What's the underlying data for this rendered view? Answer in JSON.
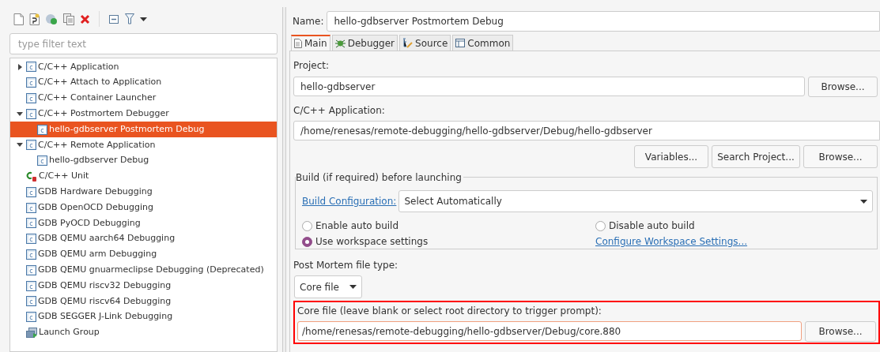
{
  "toolbar": {
    "buttons": [
      {
        "kind": "new"
      },
      {
        "kind": "new-prototype"
      },
      {
        "kind": "export"
      },
      {
        "kind": "duplicate"
      },
      {
        "kind": "delete"
      },
      {
        "kind": "collapse"
      },
      {
        "kind": "filter"
      },
      {
        "kind": "menu"
      }
    ]
  },
  "filter": {
    "placeholder": "type filter text"
  },
  "tree": [
    {
      "label": "C/C++ Application",
      "kind": "c",
      "expanded": false,
      "selected": false
    },
    {
      "label": "C/C++ Attach to Application",
      "kind": "c",
      "selected": false
    },
    {
      "label": "C/C++ Container Launcher",
      "kind": "c",
      "selected": false
    },
    {
      "label": "C/C++ Postmortem Debugger",
      "kind": "c",
      "expanded": true,
      "selected": false,
      "children": [
        {
          "label": "hello-gdbserver Postmortem Debug",
          "kind": "c",
          "selected": true
        }
      ]
    },
    {
      "label": "C/C++ Remote Application",
      "kind": "c",
      "expanded": true,
      "selected": false,
      "children": [
        {
          "label": "hello-gdbserver Debug",
          "kind": "c",
          "selected": false
        }
      ]
    },
    {
      "label": "C/C++ Unit",
      "kind": "unit",
      "selected": false
    },
    {
      "label": "GDB Hardware Debugging",
      "kind": "c",
      "selected": false
    },
    {
      "label": "GDB OpenOCD Debugging",
      "kind": "c",
      "selected": false
    },
    {
      "label": "GDB PyOCD Debugging",
      "kind": "c",
      "selected": false
    },
    {
      "label": "GDB QEMU aarch64 Debugging",
      "kind": "c",
      "selected": false
    },
    {
      "label": "GDB QEMU arm Debugging",
      "kind": "c",
      "selected": false
    },
    {
      "label": "GDB QEMU gnuarmeclipse Debugging (Deprecated)",
      "kind": "c",
      "selected": false
    },
    {
      "label": "GDB QEMU riscv32 Debugging",
      "kind": "c",
      "selected": false
    },
    {
      "label": "GDB QEMU riscv64 Debugging",
      "kind": "c",
      "selected": false
    },
    {
      "label": "GDB SEGGER J-Link Debugging",
      "kind": "c",
      "selected": false
    },
    {
      "label": "Launch Group",
      "kind": "group",
      "selected": false
    }
  ],
  "name": {
    "label": "Name:",
    "value": "hello-gdbserver Postmortem Debug"
  },
  "tabs": [
    {
      "label": "Main",
      "kind": "main",
      "selected": true
    },
    {
      "label": "Debugger",
      "kind": "debugger",
      "selected": false
    },
    {
      "label": "Source",
      "kind": "source",
      "selected": false
    },
    {
      "label": "Common",
      "kind": "common",
      "selected": false
    }
  ],
  "project": {
    "label": "Project:",
    "value": "hello-gdbserver",
    "button": "Browse..."
  },
  "application": {
    "label": "C/C++ Application:",
    "value": "/home/renesas/remote-debugging/hello-gdbserver/Debug/hello-gdbserver",
    "buttons": [
      "Variables...",
      "Search Project...",
      "Browse..."
    ]
  },
  "build": {
    "title": "Build (if required) before launching",
    "config_link": "Build Configuration:",
    "config_value": "Select Automatically",
    "options": [
      {
        "label": "Enable auto build",
        "selected": false
      },
      {
        "label": "Disable auto build",
        "selected": false
      },
      {
        "label": "Use workspace settings",
        "selected": true
      }
    ],
    "workspace_link": "Configure Workspace Settings..."
  },
  "post_mortem": {
    "label": "Post Mortem file type:",
    "value": "Core file"
  },
  "core_file": {
    "label": "Core file (leave blank or select root directory to trigger prompt):",
    "value": "/home/renesas/remote-debugging/hello-gdbserver/Debug/core.880",
    "button": "Browse...",
    "highlighted": true
  }
}
